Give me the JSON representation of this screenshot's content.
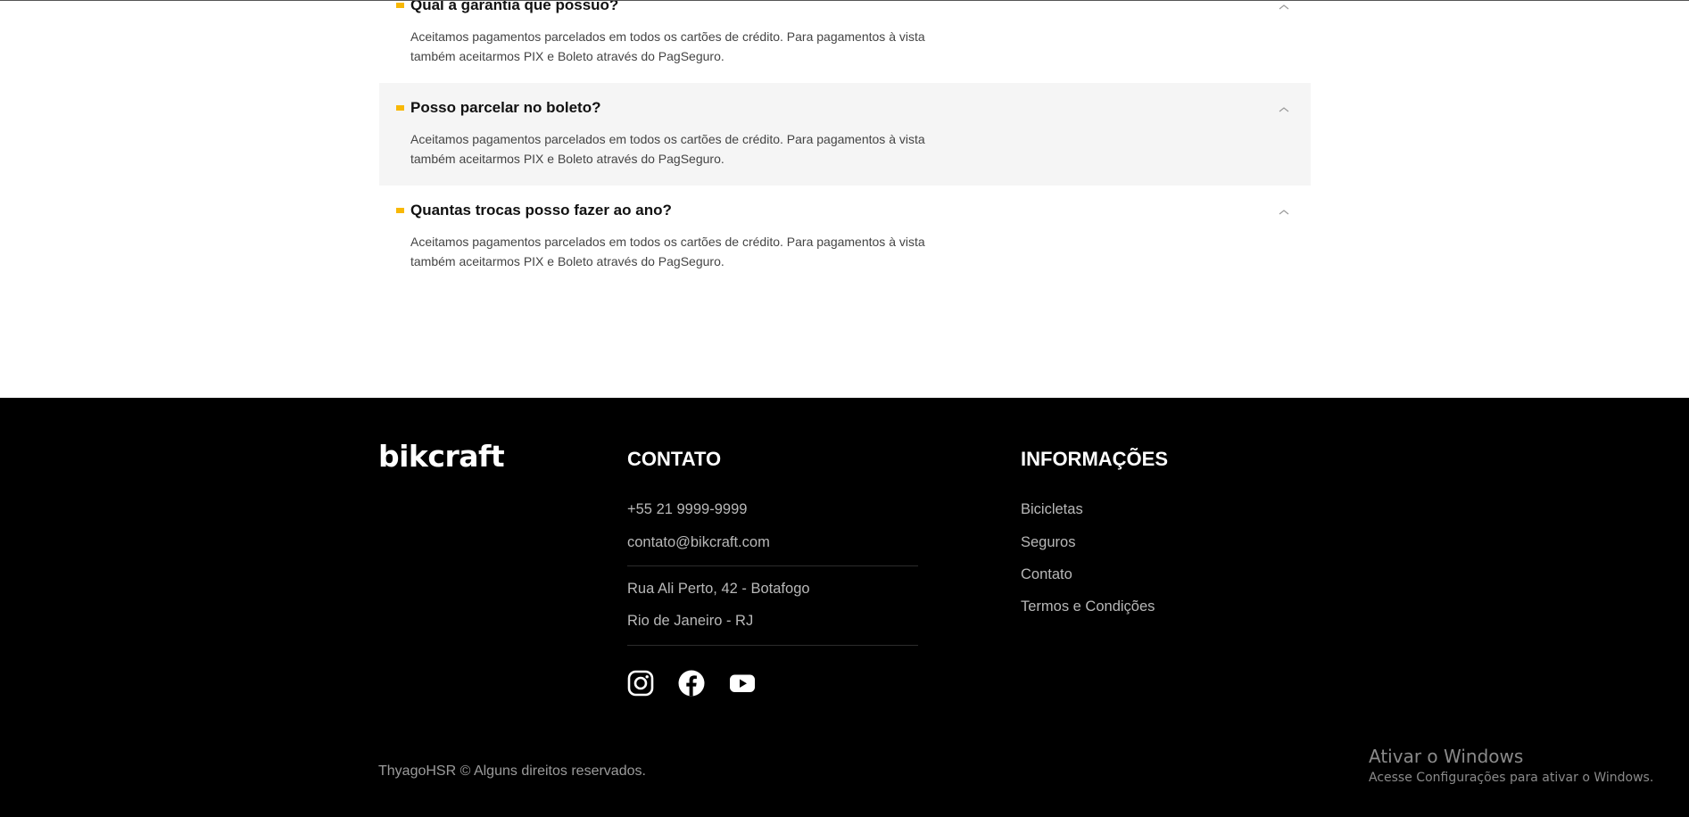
{
  "faq": {
    "items": [
      {
        "question": "Qual a garantia que possuo?",
        "answer": "Aceitamos pagamentos parcelados em todos os cartões de crédito. Para pagamentos à vista também aceitarmos PIX e Boleto através do PagSeguro.",
        "expanded": true,
        "highlighted": false
      },
      {
        "question": "Posso parcelar no boleto?",
        "answer": "Aceitamos pagamentos parcelados em todos os cartões de crédito. Para pagamentos à vista também aceitarmos PIX e Boleto através do PagSeguro.",
        "expanded": true,
        "highlighted": true
      },
      {
        "question": "Quantas trocas posso fazer ao ano?",
        "answer": "Aceitamos pagamentos parcelados em todos os cartões de crédito. Para pagamentos à vista também aceitarmos PIX e Boleto através do PagSeguro.",
        "expanded": true,
        "highlighted": false
      }
    ]
  },
  "footer": {
    "logo": "bikcraft",
    "contact": {
      "title": "CONTATO",
      "phone": "+55 21 9999-9999",
      "email": "contato@bikcraft.com",
      "address_line1": "Rua Ali Perto, 42 - Botafogo",
      "address_line2": "Rio de Janeiro - RJ",
      "social": [
        "instagram-icon",
        "facebook-icon",
        "youtube-icon"
      ]
    },
    "info": {
      "title": "INFORMAÇÕES",
      "links": [
        "Bicicletas",
        "Seguros",
        "Contato",
        "Termos e Condições"
      ]
    },
    "copyright": "ThyagoHSR © Alguns direitos reservados."
  },
  "watermark": {
    "title": "Ativar o Windows",
    "subtitle": "Acesse Configurações para ativar o Windows."
  },
  "colors": {
    "accent": "#f8b805",
    "footer_bg": "#000000",
    "faq_highlight_bg": "#f5f5f5"
  }
}
